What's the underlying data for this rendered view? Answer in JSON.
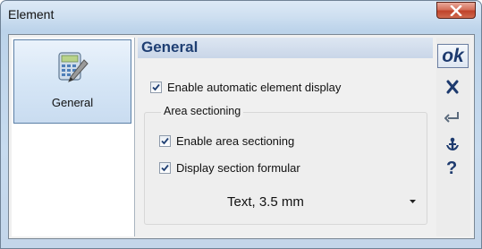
{
  "window": {
    "title": "Element"
  },
  "nav": {
    "items": [
      {
        "label": "General",
        "icon": "calculator-pencil-icon",
        "selected": true
      }
    ]
  },
  "panel": {
    "title": "General",
    "enable_auto_display": {
      "label": "Enable automatic element display",
      "checked": true
    },
    "area_sectioning": {
      "label": "Area sectioning",
      "enable_area_sectioning": {
        "label": "Enable area sectioning",
        "checked": true
      },
      "display_section_formular": {
        "label": "Display section formular",
        "checked": true
      },
      "text_style": {
        "value": "Text, 3.5 mm"
      }
    }
  },
  "toolbar": {
    "ok_label": "ok",
    "icons": [
      "cancel-x-icon",
      "enter-return-icon",
      "anchor-icon",
      "help-question-icon"
    ],
    "help_label": "?"
  },
  "colors": {
    "accent": "#1f3f73",
    "close": "#c0432a"
  }
}
